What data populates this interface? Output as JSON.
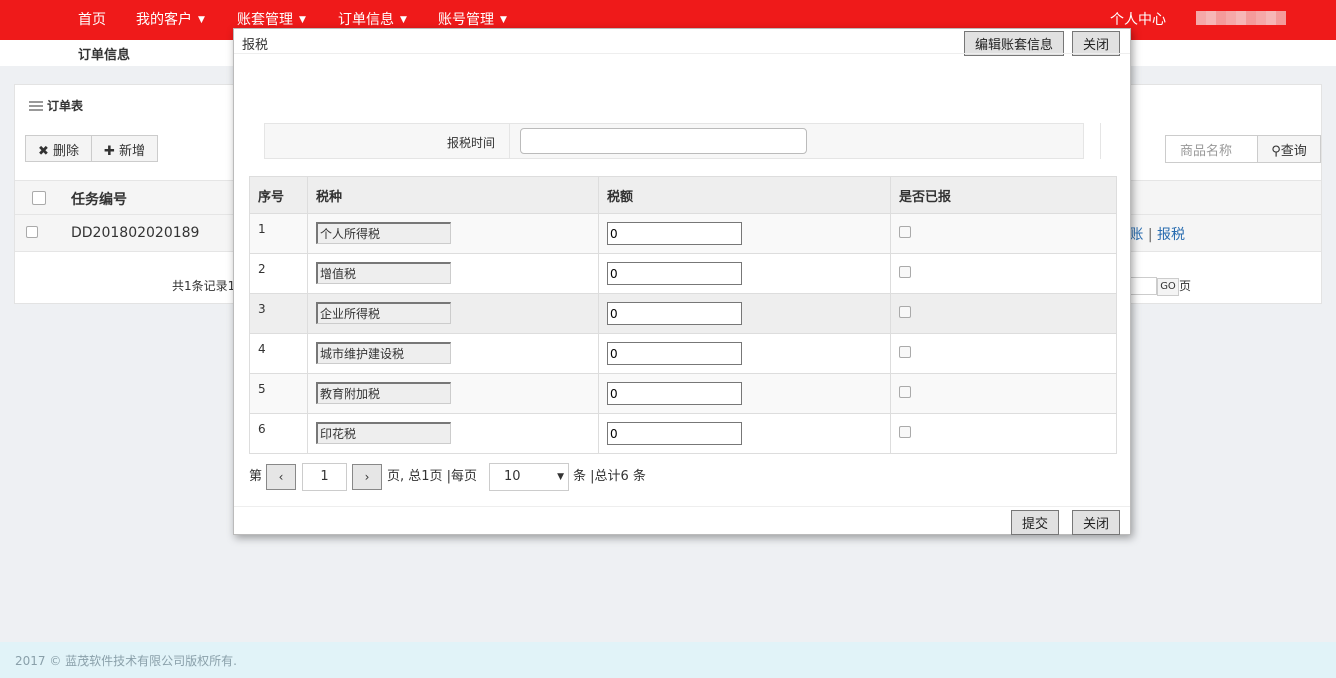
{
  "nav": {
    "items": [
      {
        "label": "首页",
        "caret": ""
      },
      {
        "label": "我的客户",
        "caret": "▼"
      },
      {
        "label": "账套管理",
        "caret": "▼"
      },
      {
        "label": "订单信息",
        "caret": "▼"
      },
      {
        "label": "账号管理",
        "caret": "▼"
      }
    ],
    "personal_center": "个人中心"
  },
  "breadcrumb": "订单信息",
  "panel": {
    "title": "订单表",
    "delete_label": "✖ 删除",
    "add_label": "✚ 新增",
    "search_placeholder": "商品名称",
    "search_label": "查询",
    "col_task_no": "任务编号",
    "row_task_no": "DD201802020189",
    "row_link_1": "账",
    "row_link_sep": " | ",
    "row_link_2": "报税",
    "records_text": "共1条记录1",
    "go_label": "GO",
    "page_suffix": "页"
  },
  "modal": {
    "title": "报税",
    "edit_button": "编辑账套信息",
    "close_top": "关闭",
    "tax_time_label": "报税时间",
    "tax_time_value": "",
    "columns": [
      "序号",
      "税种",
      "税额",
      "是否已报"
    ],
    "rows": [
      {
        "no": "1",
        "type": "个人所得税",
        "amount": "0",
        "reported": false
      },
      {
        "no": "2",
        "type": "增值税",
        "amount": "0",
        "reported": false
      },
      {
        "no": "3",
        "type": "企业所得税",
        "amount": "0",
        "reported": false
      },
      {
        "no": "4",
        "type": "城市维护建设税",
        "amount": "0",
        "reported": false
      },
      {
        "no": "5",
        "type": "教育附加税",
        "amount": "0",
        "reported": false
      },
      {
        "no": "6",
        "type": "印花税",
        "amount": "0",
        "reported": false
      }
    ],
    "pager": {
      "prefix": "第",
      "prev": "‹",
      "current": "1",
      "next": "›",
      "pages_text": "页,  总1页 |每页",
      "page_size": "10",
      "suffix": "条 |总计6 条"
    },
    "submit": "提交",
    "close_bottom": "关闭"
  },
  "footer": "2017 © 蓝茂软件技术有限公司版权所有."
}
